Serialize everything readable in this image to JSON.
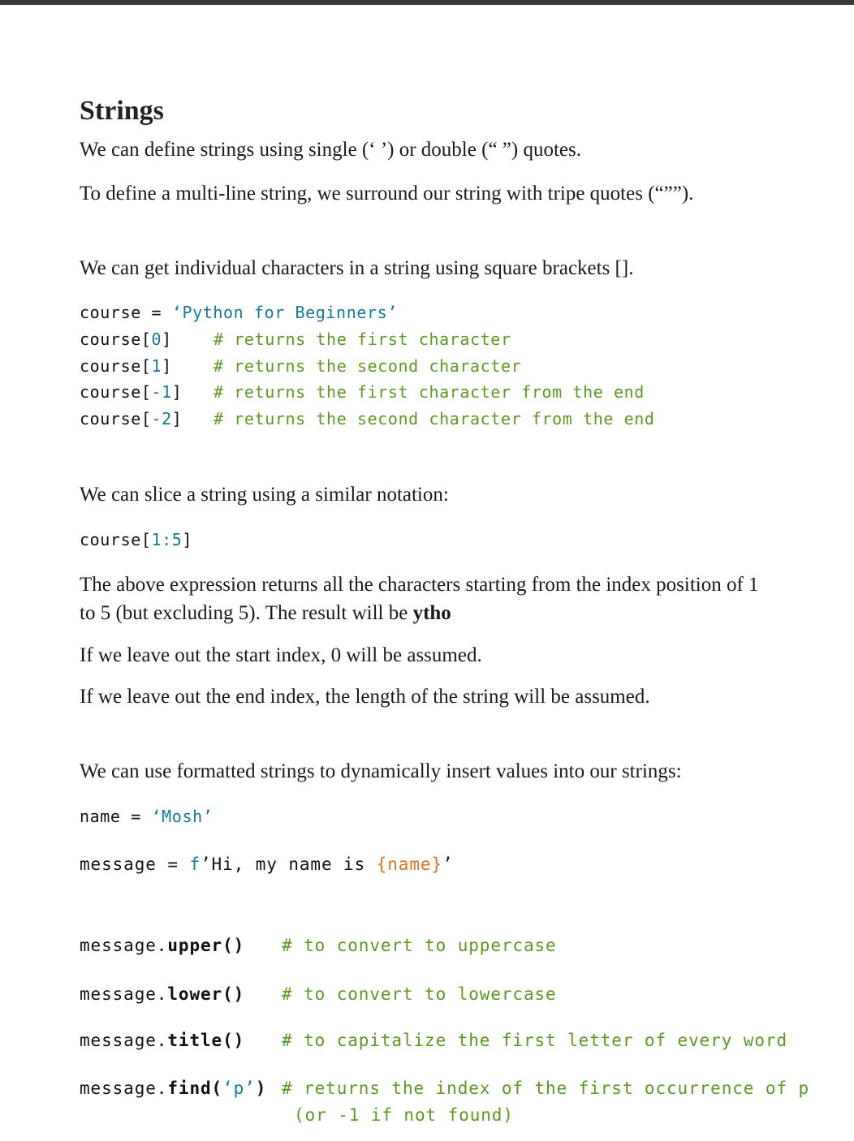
{
  "heading": "Strings",
  "intro": {
    "quotes_prefix": "We can define strings using single (",
    "single_quote": "‘  ’",
    "quotes_mid": ") or double (",
    "double_quote": "“  ”",
    "quotes_suffix": ") quotes.",
    "multiline_prefix": "To define a multi-line string, we surround our string with tripe quotes (",
    "triple_quote": "“””",
    "multiline_suffix": ")."
  },
  "indexing": {
    "text": "We can get individual characters in a string using square brackets [].",
    "assign": {
      "var": "course",
      "op": " = ",
      "value": "‘Python for Beginners’"
    },
    "lines": [
      {
        "prefix": "course[",
        "index": "0",
        "suffix": "]",
        "comment": "# returns the first character"
      },
      {
        "prefix": "course[",
        "index": "1",
        "suffix": "]",
        "comment": "# returns the second character"
      },
      {
        "prefix": "course[",
        "index": "-1",
        "suffix": "]",
        "comment": "# returns the first character from the end"
      },
      {
        "prefix": "course[",
        "index": "-2",
        "suffix": "]",
        "comment": "# returns the second character from the end"
      }
    ]
  },
  "slicing": {
    "text": "We can slice a string using a similar notation:",
    "code_prefix": "course[",
    "code_range": "1:5",
    "code_suffix": "]",
    "explain_line1": "The above expression returns all the characters starting from the index position of 1",
    "explain_line2_prefix": "to 5 (but excluding 5). The result will be ",
    "explain_result": "ytho",
    "start_note": "If we leave out the start index, 0 will be assumed.",
    "end_note": "If we leave out the end index, the length of the string will be assumed."
  },
  "formatted": {
    "text": "We can use formatted strings to dynamically insert values into our strings:",
    "name_var": "name",
    "name_op": " = ",
    "name_value": "‘Mosh’",
    "msg_var": "message",
    "msg_op": " = ",
    "msg_fprefix": "f",
    "msg_text": "’Hi, my name is ",
    "msg_interp": "{name}",
    "msg_close": "’"
  },
  "methods": [
    {
      "obj": "message.",
      "name": "upper()",
      "pad": "   ",
      "comment": "# to convert to uppercase"
    },
    {
      "obj": "message.",
      "name": "lower()",
      "pad": "   ",
      "comment": "# to convert to lowercase"
    },
    {
      "obj": "message.",
      "name": "title()",
      "pad": "   ",
      "comment": "# to capitalize the first letter of every word"
    }
  ],
  "find": {
    "obj": "message.",
    "name": "find(",
    "arg": "‘p’",
    "close": ")",
    "comment": "# returns the index of the first occurrence of p",
    "comment_cont": "(or -1 if not found)"
  }
}
